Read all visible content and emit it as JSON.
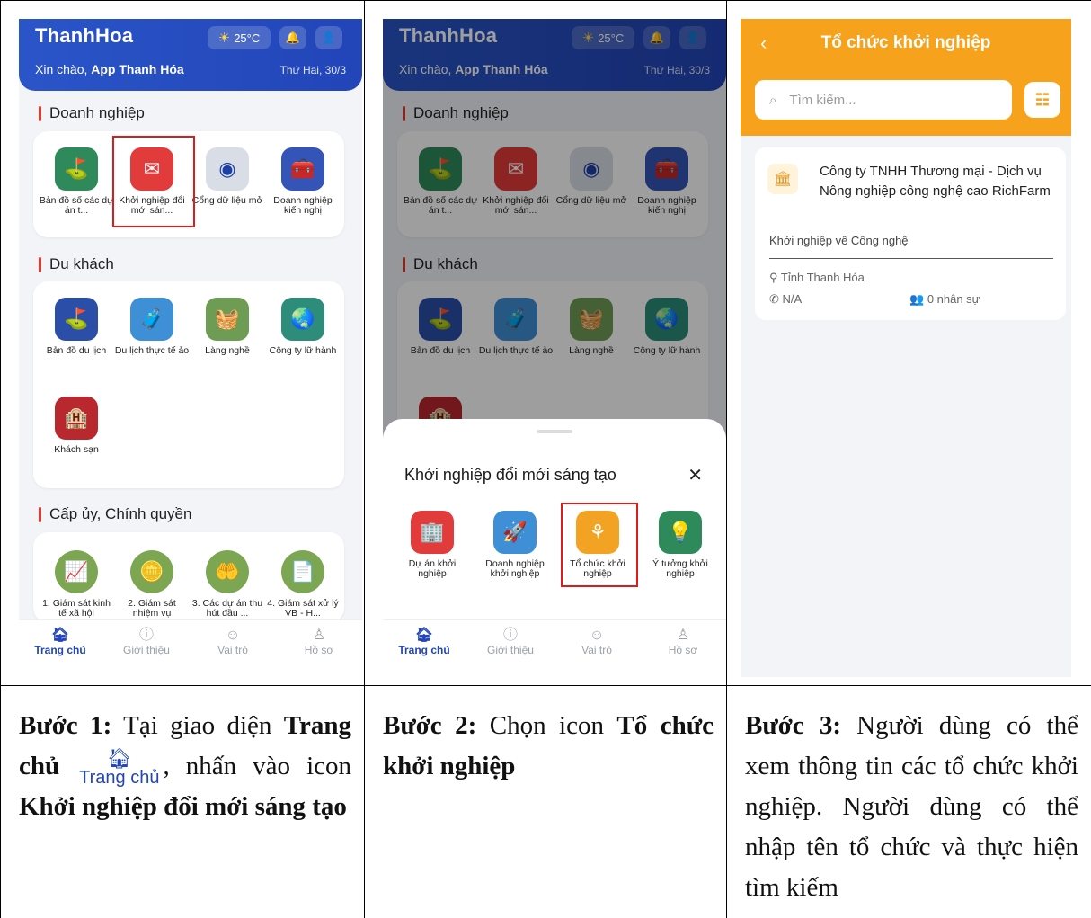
{
  "screen1": {
    "brand": "ThanhHoa",
    "weather": "25°C",
    "greeting_prefix": "Xin chào, ",
    "greeting_name": "App Thanh Hóa",
    "date": "Thứ Hai, 30/3",
    "sections": {
      "business": "Doanh nghiệp",
      "tourist": "Du khách",
      "government": "Cấp ủy, Chính quyền"
    },
    "business_items": [
      "Bản đồ số các dự án t...",
      "Khởi nghiệp đổi mới sán...",
      "Cổng dữ liệu mở",
      "Doanh nghiệp kiến nghị"
    ],
    "tourist_items": [
      "Bản đồ du lịch",
      "Du lịch thực tế ảo",
      "Làng nghề",
      "Công ty lữ hành",
      "Khách sạn"
    ],
    "gov_items": [
      "1. Giám sát kinh tế xã hội",
      "2. Giám sát nhiệm vụ",
      "3. Các dự án thu hút đầu ...",
      "4. Giám sát xử lý VB - H..."
    ]
  },
  "screen2": {
    "sheet_title": "Khởi nghiệp đổi mới sáng tạo",
    "sheet_items": [
      "Dự án khởi nghiệp",
      "Doanh nghiệp khởi nghiệp",
      "Tổ chức khởi nghiệp",
      "Ý tưởng khởi nghiệp"
    ]
  },
  "bottom_nav": [
    "Trang chủ",
    "Giới thiệu",
    "Vai trò",
    "Hồ sơ"
  ],
  "screen3": {
    "title": "Tổ chức khởi nghiệp",
    "search_placeholder": "Tìm kiếm...",
    "org_name": "Công ty TNHH Thương mại - Dịch vụ Nông nghiệp công nghệ cao RichFarm",
    "org_category": "Khởi nghiệp về Công nghệ",
    "org_location": "Tỉnh Thanh Hóa",
    "org_phone": "N/A",
    "org_staff": "0 nhân sự"
  },
  "steps": {
    "s1_label": "Bước 1:",
    "s1_a": " Tại giao diện ",
    "s1_b": "Trang chủ",
    "s1_chip": "Trang chủ",
    "s1_c": ", nhấn vào icon ",
    "s1_d": "Khởi nghiệp đổi mới sáng tạo",
    "s2_label": "Bước 2:",
    "s2_a": " Chọn icon ",
    "s2_b": "Tổ chức khởi nghiệp",
    "s3_label": "Bước 3:",
    "s3_a": " Người dùng có thể xem thông tin các tổ chức khởi nghiệp. Người dùng có thể nhập tên tổ chức và thực hiện tìm kiếm"
  }
}
